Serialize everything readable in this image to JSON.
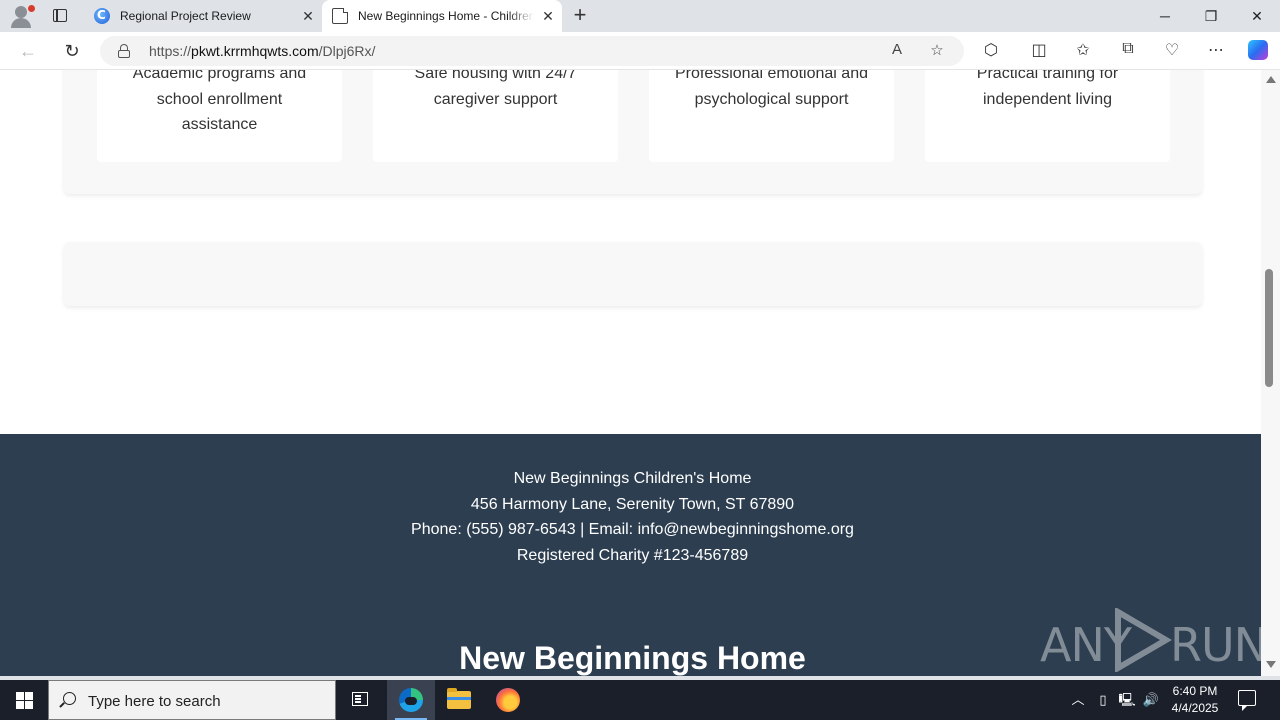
{
  "browser": {
    "tabs": [
      {
        "title": "Regional Project Review",
        "favicon": "copilot-c-icon",
        "active": false
      },
      {
        "title": "New Beginnings Home - Children's",
        "favicon": "document-icon",
        "active": true
      }
    ],
    "address": {
      "scheme": "https://",
      "host": "pkwt.krrmhqwts.com",
      "path": "/Dlpj6Rx/"
    }
  },
  "page": {
    "cards": [
      {
        "text": "Academic programs and school enrollment assistance"
      },
      {
        "text": "Safe housing with 24/7 caregiver support"
      },
      {
        "text": "Professional emotional and psychological support"
      },
      {
        "text": "Practical training for independent living"
      }
    ],
    "footer": {
      "org_name": "New Beginnings Children's Home",
      "address": "456 Harmony Lane, Serenity Town, ST 67890",
      "contact": "Phone: (555) 987-6543 | Email: info@newbeginningshome.org",
      "charity": "Registered Charity #123-456789",
      "brand": "New Beginnings Home"
    },
    "colors": {
      "footer_bg": "#2c3e50",
      "panel_bg": "#f8f8f8"
    }
  },
  "watermark": {
    "text_left": "ANY",
    "text_right": "RUN"
  },
  "taskbar": {
    "search_placeholder": "Type here to search",
    "time": "6:40 PM",
    "date": "4/4/2025"
  }
}
